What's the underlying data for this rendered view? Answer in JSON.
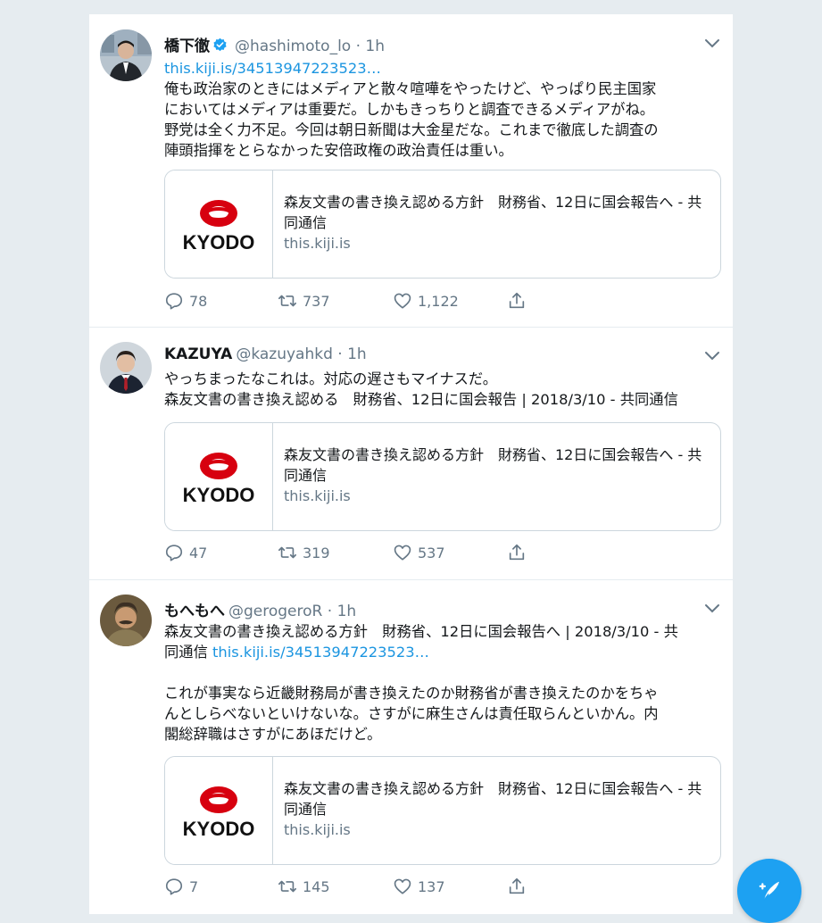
{
  "tweets": [
    {
      "name": "橋下徹",
      "verified": true,
      "handle": "@hashimoto_lo",
      "time": "1h",
      "body_lines": [
        {
          "parts": [
            {
              "text": "this.kiji.is/34513947223523…",
              "link": true
            }
          ]
        },
        {
          "parts": [
            {
              "text": "俺も政治家のときにはメディアと散々喧嘩をやったけど、やっぱり民主国家",
              "link": false
            }
          ]
        },
        {
          "parts": [
            {
              "text": "においてはメディアは重要だ。しかもきっちりと調査できるメディアがね。",
              "link": false
            }
          ]
        },
        {
          "parts": [
            {
              "text": "野党は全く力不足。今回は朝日新聞は大金星だな。これまで徹底した調査の",
              "link": false
            }
          ]
        },
        {
          "parts": [
            {
              "text": "陣頭指揮をとらなかった安倍政権の政治責任は重い。",
              "link": false
            }
          ]
        }
      ],
      "card": {
        "title": "森友文書の書き換え認める方針　財務省、12日に国会報告へ - 共同通信",
        "domain": "this.kiji.is",
        "logo_text": "KYODO"
      },
      "replies": "78",
      "retweets": "737",
      "likes": "1,122"
    },
    {
      "name": "KAZUYA",
      "verified": false,
      "handle": "@kazuyahkd",
      "time": "1h",
      "body_lines": [
        {
          "parts": [
            {
              "text": "やっちまったなこれは。対応の遅さもマイナスだ。",
              "link": false
            }
          ]
        },
        {
          "parts": [
            {
              "text": "森友文書の書き換え認める　財務省、12日に国会報告 | 2018/3/10 - 共同通信",
              "link": false
            }
          ]
        }
      ],
      "card": {
        "title": "森友文書の書き換え認める方針　財務省、12日に国会報告へ - 共同通信",
        "domain": "this.kiji.is",
        "logo_text": "KYODO"
      },
      "replies": "47",
      "retweets": "319",
      "likes": "537"
    },
    {
      "name": "もへもへ",
      "verified": false,
      "handle": "@gerogeroR",
      "time": "1h",
      "body_lines": [
        {
          "parts": [
            {
              "text": "森友文書の書き換え認める方針　財務省、12日に国会報告へ | 2018/3/10 - 共",
              "link": false
            }
          ]
        },
        {
          "parts": [
            {
              "text": "同通信 ",
              "link": false
            },
            {
              "text": "this.kiji.is/34513947223523…",
              "link": true
            }
          ]
        },
        {
          "parts": [
            {
              "text": "",
              "link": false
            }
          ]
        },
        {
          "parts": [
            {
              "text": "これが事実なら近畿財務局が書き換えたのか財務省が書き換えたのかをちゃ",
              "link": false
            }
          ]
        },
        {
          "parts": [
            {
              "text": "んとしらべないといけないな。さすがに麻生さんは責任取らんといかん。内",
              "link": false
            }
          ]
        },
        {
          "parts": [
            {
              "text": "閣総辞職はさすがにあほだけど。",
              "link": false
            }
          ]
        }
      ],
      "card": {
        "title": "森友文書の書き換え認める方針　財務省、12日に国会報告へ - 共同通信",
        "domain": "this.kiji.is",
        "logo_text": "KYODO"
      },
      "replies": "7",
      "retweets": "145",
      "likes": "137"
    }
  ],
  "icons": {
    "reply": "reply-icon",
    "retweet": "retweet-icon",
    "like": "heart-icon",
    "share": "share-icon",
    "compose": "compose-tweet-icon",
    "verified": "verified-badge-icon",
    "caret": "chevron-down-icon"
  },
  "colors": {
    "accent": "#1da1f2",
    "link": "#1b95e0",
    "muted": "#657786",
    "background": "#e6ecf0",
    "kyodo_red": "#d7000f"
  }
}
